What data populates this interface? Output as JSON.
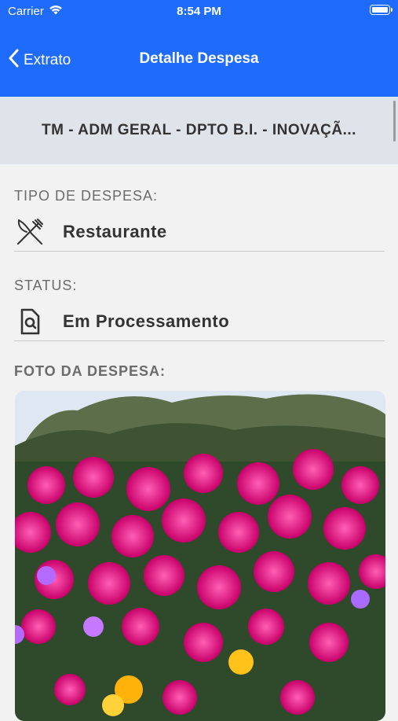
{
  "status_bar": {
    "carrier": "Carrier",
    "time": "8:54 PM"
  },
  "nav": {
    "back_label": "Extrato",
    "title": "Detalhe Despesa"
  },
  "banner": {
    "text": "TM - ADM GERAL - DPTO B.I. - INOVAÇÃ..."
  },
  "expense": {
    "type_label": "TIPO DE DESPESA:",
    "type_value": "Restaurante",
    "type_icon": "fork-knife-icon",
    "status_label": "STATUS:",
    "status_value": "Em Processamento",
    "status_icon": "document-search-icon",
    "photo_label": "FOTO DA DESPESA:"
  },
  "colors": {
    "header": "#1f6bfb",
    "banner": "#dfe3ea",
    "background": "#f2f2f2"
  }
}
